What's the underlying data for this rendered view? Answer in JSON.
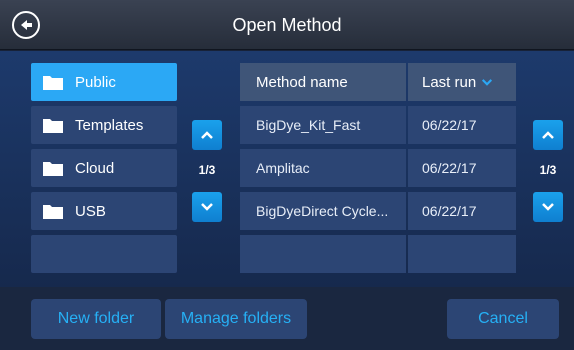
{
  "header": {
    "title": "Open Method",
    "back_icon": "back-arrow-icon"
  },
  "folders": [
    {
      "label": "Public",
      "selected": true
    },
    {
      "label": "Templates",
      "selected": false
    },
    {
      "label": "Cloud",
      "selected": false
    },
    {
      "label": "USB",
      "selected": false
    },
    {
      "label": "",
      "selected": false
    }
  ],
  "folder_pager": {
    "page": "1/3"
  },
  "methods": {
    "columns": {
      "name": "Method name",
      "last_run": "Last run",
      "sort_icon": "chevron-down-icon"
    },
    "rows": [
      {
        "name": "BigDye_Kit_Fast",
        "last_run": "06/22/17"
      },
      {
        "name": "Amplitac",
        "last_run": "06/22/17"
      },
      {
        "name": "BigDyeDirect Cycle...",
        "last_run": "06/22/17"
      },
      {
        "name": "",
        "last_run": ""
      }
    ]
  },
  "method_pager": {
    "page": "1/3"
  },
  "footer": {
    "new_folder": "New folder",
    "manage_folders": "Manage folders",
    "cancel": "Cancel"
  },
  "colors": {
    "accent": "#2ba8f5",
    "button_text": "#26b0f5",
    "panel": "#2c4574",
    "background": "#172238"
  }
}
